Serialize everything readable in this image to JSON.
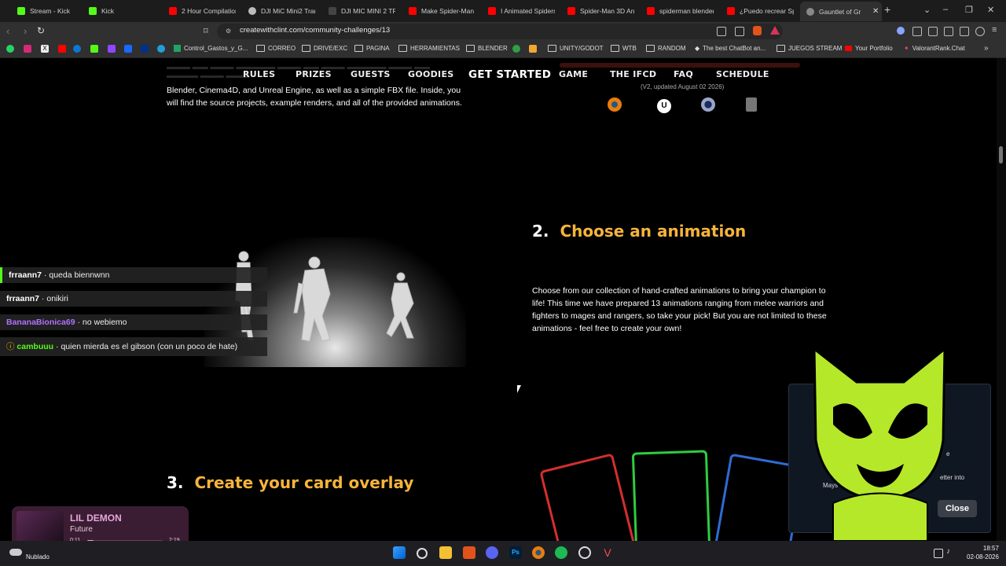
{
  "tabs": [
    {
      "title": "Stream - Kick D",
      "color": "#53fc18"
    },
    {
      "title": "Kick",
      "color": "#53fc18"
    },
    {
      "title": "2 Hour Compilation",
      "color": "#ff0000"
    },
    {
      "title": "DJI MiC Mini2 Tran",
      "color": "#bbbbbb"
    },
    {
      "title": "DJI MIC MINI 2 TR",
      "color": "#444444"
    },
    {
      "title": "Make Spider-Man",
      "color": "#ff0000"
    },
    {
      "title": "I Animated Spiderm",
      "color": "#ff0000"
    },
    {
      "title": "Spider-Man 3D An",
      "color": "#ff0000"
    },
    {
      "title": "spiderman blender",
      "color": "#ff0000"
    },
    {
      "title": "¿Puedo recrear Sp",
      "color": "#ff0000"
    },
    {
      "title": "Gauntlet of Gr",
      "color": "#888888"
    }
  ],
  "window_controls": {
    "new_tab": "+",
    "dropdown": "⌄",
    "minimize": "–",
    "maximize": "❐",
    "close": "✕"
  },
  "address": {
    "url": "createwithclint.com/community-challenges/13"
  },
  "bookmarks": [
    {
      "label": "Control_Gastos_y_G...",
      "kind": "page"
    },
    {
      "label": "CORREO",
      "kind": "folder"
    },
    {
      "label": "DRIVE/EXC",
      "kind": "folder"
    },
    {
      "label": "PAGINA",
      "kind": "folder"
    },
    {
      "label": "HERRAMIENTAS",
      "kind": "folder"
    },
    {
      "label": "BLENDER",
      "kind": "folder"
    },
    {
      "label": "UNITY/GODOT",
      "kind": "folder"
    },
    {
      "label": "WTB",
      "kind": "folder"
    },
    {
      "label": "RANDOM",
      "kind": "folder"
    },
    {
      "label": "The best ChatBot an...",
      "kind": "page"
    },
    {
      "label": "JUEGOS STREAM",
      "kind": "folder"
    },
    {
      "label": "Your Portfolio",
      "kind": "page"
    },
    {
      "label": "ValorantRank.Chat",
      "kind": "page"
    }
  ],
  "site_nav": [
    "RULES",
    "PRIZES",
    "GUESTS",
    "GOODIES",
    "GET STARTED",
    "GAME",
    "THE IFCD",
    "FAQ",
    "SCHEDULE"
  ],
  "step1": {
    "text": "Blender, Cinema4D, and Unreal Engine, as well as a simple FBX file. Inside, you will find the source projects, example renders, and all of the provided animations.",
    "updated": "(V2, updated August 02 2026)"
  },
  "step2": {
    "number": "2.",
    "title": "Choose an animation",
    "text": "Choose from our collection of hand-crafted animations to bring your champion to life! This time we have prepared 13 animations ranging from melee warriors and fighters to mages and rangers, so take your pick! But you are not limited to these animations - feel free to create your own!"
  },
  "step3": {
    "number": "3.",
    "title": "Create your card overlay"
  },
  "chat": [
    {
      "user": "frraann7",
      "message": "queda biennwnn",
      "color": "#ffffff"
    },
    {
      "user": "frraann7",
      "message": "onikiri",
      "color": "#ffffff"
    },
    {
      "user": "BananaBionica69",
      "message": "no webiemo",
      "color": "#b072ff"
    },
    {
      "user": "cambuuu",
      "message": "quien mierda es el gibson (con un poco de hate)",
      "color": "#53fc18"
    }
  ],
  "popup": {
    "fragment1": "e",
    "fragment2": "etter into",
    "fragment3": "Mays",
    "close_label": "Close"
  },
  "music": {
    "title": "LIL DEMON",
    "artist": "Future",
    "elapsed": "0:11",
    "total": "2:19",
    "progress": 0.08
  },
  "weather": {
    "label": "Nublado"
  },
  "clock": {
    "time": "18:57",
    "date": "02-08-2026"
  }
}
